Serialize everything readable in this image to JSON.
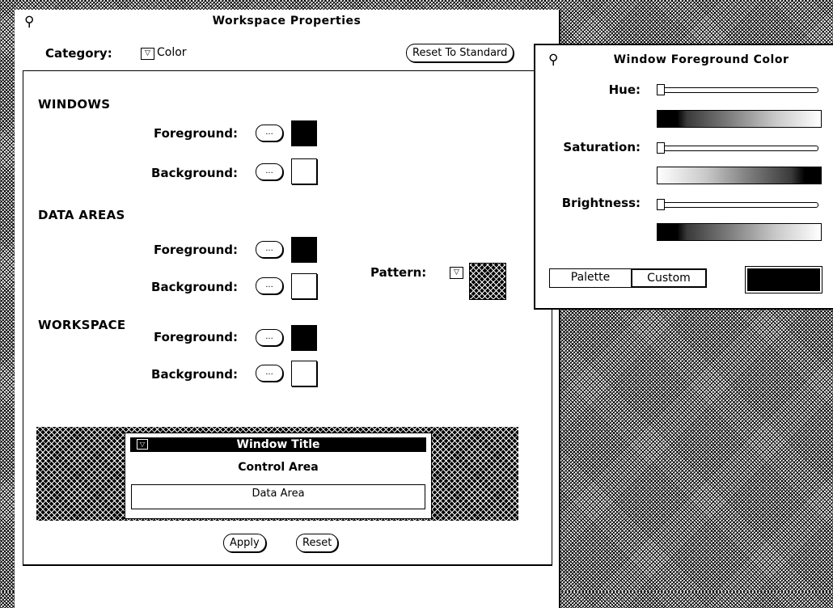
{
  "workspace": {
    "title": "Workspace Properties",
    "category_label": "Category:",
    "category_value": "Color",
    "reset_standard": "Reset To Standard",
    "sections": {
      "windows": "WINDOWS",
      "data_areas": "DATA AREAS",
      "workspace": "WORKSPACE"
    },
    "foreground_label": "Foreground:",
    "background_label": "Background:",
    "ellipsis": "...",
    "pattern_label": "Pattern:",
    "preview": {
      "window_title": "Window Title",
      "control_area": "Control Area",
      "data_area": "Data Area"
    },
    "apply": "Apply",
    "reset": "Reset"
  },
  "color_popup": {
    "title": "Window Foreground Color",
    "hue_label": "Hue:",
    "saturation_label": "Saturation:",
    "brightness_label": "Brightness:",
    "hue_value": 0,
    "saturation_value": 0,
    "brightness_value": 0,
    "palette_tab": "Palette",
    "custom_tab": "Custom",
    "current_color": "#000000"
  },
  "icons": {
    "pushpin": "pushpin-icon",
    "menu": "menu-arrow-icon"
  }
}
